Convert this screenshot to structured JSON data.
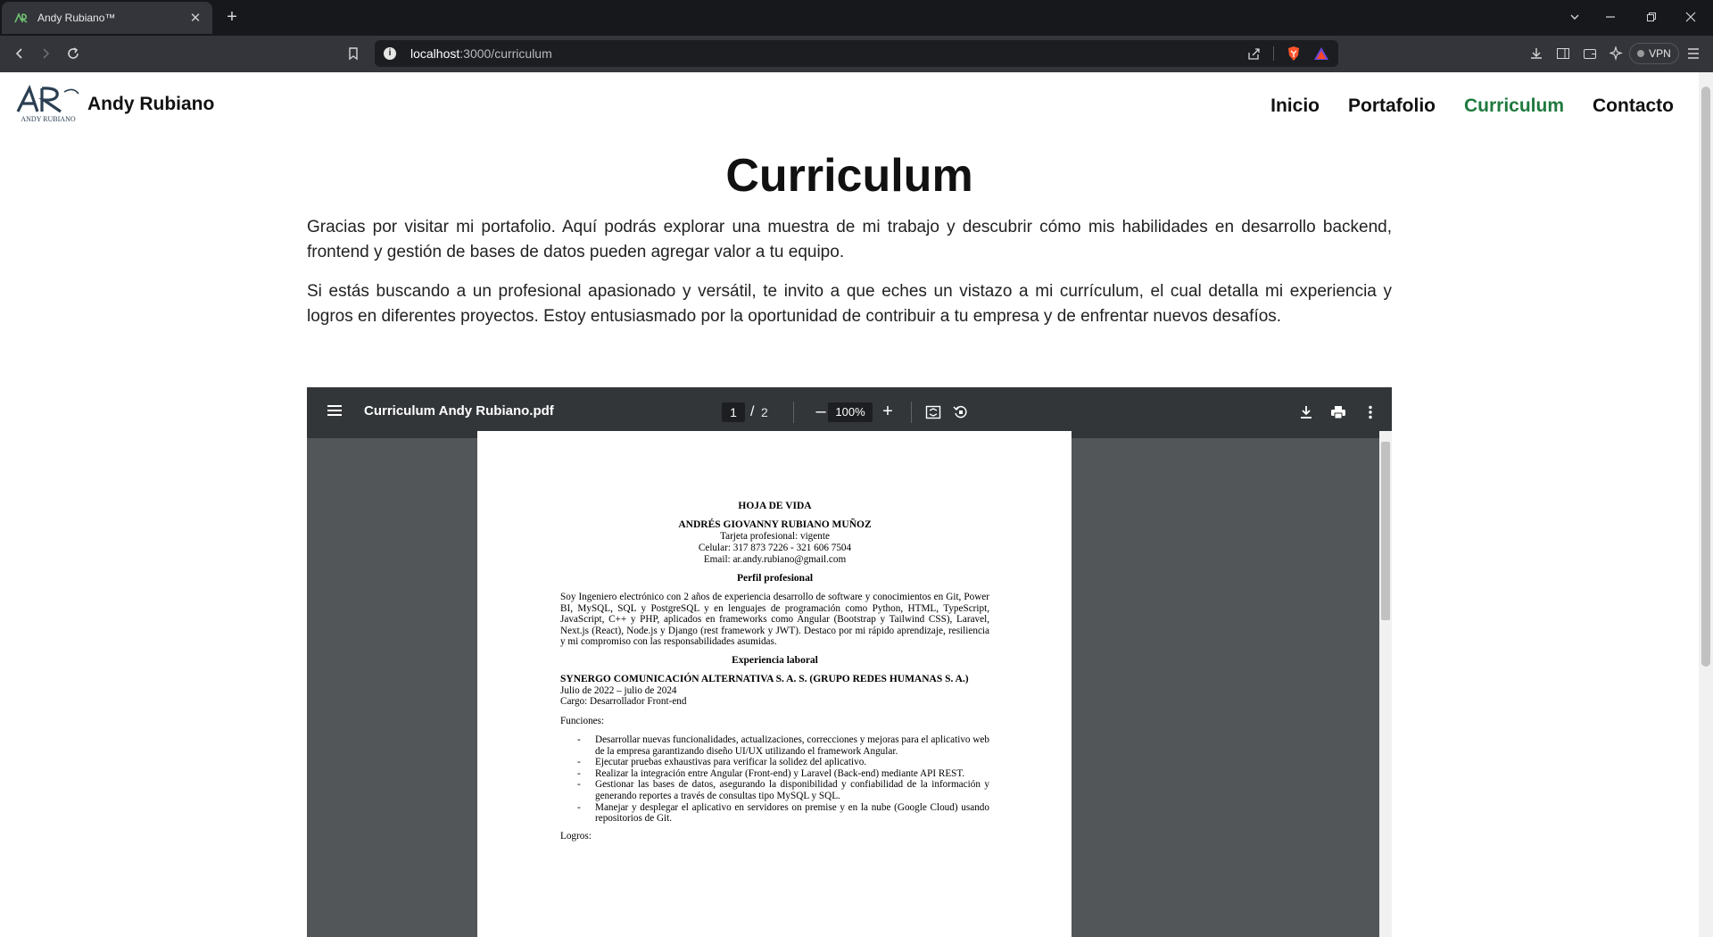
{
  "browser": {
    "tab_title": "Andy Rubiano™",
    "new_tab_label": "+",
    "url_host": "localhost",
    "url_path": ":3000/curriculum",
    "vpn_label": "VPN"
  },
  "site": {
    "brand_name": "Andy Rubiano",
    "logo_text": "AR",
    "logo_subtext": "ANDY RUBIANO",
    "nav": {
      "inicio": "Inicio",
      "portafolio": "Portafolio",
      "curriculum": "Curriculum",
      "contacto": "Contacto"
    },
    "active_nav": "curriculum",
    "accent_color": "#1f7a3e"
  },
  "main": {
    "title": "Curriculum",
    "intro_p1": "Gracias por visitar mi portafolio. Aquí podrás explorar una muestra de mi trabajo y descubrir cómo mis habilidades en desarrollo backend, frontend y gestión de bases de datos pueden agregar valor a tu equipo.",
    "intro_p2": "Si estás buscando a un profesional apasionado y versátil, te invito a que eches un vistazo a mi currículum, el cual detalla mi experiencia y logros en diferentes proyectos. Estoy entusiasmado por la oportunidad de contribuir a tu empresa y de enfrentar nuevos desafíos."
  },
  "pdf": {
    "filename": "Curriculum Andy Rubiano.pdf",
    "current_page": "1",
    "page_separator": "/",
    "total_pages": "2",
    "zoom": "100%",
    "zoom_minus": "–",
    "zoom_plus": "+",
    "doc": {
      "heading": "HOJA DE VIDA",
      "name": "ANDRÉS GIOVANNY RUBIANO MUÑOZ",
      "professional_card": "Tarjeta profesional: vigente",
      "phone": "Celular: 317 873 7226 - 321 606 7504",
      "email": "Email: ar.andy.rubiano@gmail.com",
      "profile_heading": "Perfil profesional",
      "profile_text": "Soy Ingeniero electrónico con 2 años de experiencia desarrollo de software y conocimientos en Git, Power BI, MySQL, SQL y PostgreSQL y en lenguajes de programación como Python, HTML, TypeScript, JavaScript, C++ y PHP, aplicados en frameworks como Angular (Bootstrap y Tailwind CSS), Laravel, Next.js (React), Node.js y Django (rest framework y JWT). Destaco por mi rápido aprendizaje, resiliencia y mi compromiso con las responsabilidades asumidas.",
      "experience_heading": "Experiencia laboral",
      "company": "SYNERGO COMUNICACIÓN ALTERNATIVA S. A. S. (GRUPO REDES HUMANAS S. A.)",
      "period": "Julio de 2022 – julio de 2024",
      "role": "Cargo: Desarrollador Front-end",
      "functions_label": "Funciones:",
      "bullet": "-",
      "functions": [
        "Desarrollar nuevas funcionalidades, actualizaciones, correcciones y mejoras para el aplicativo web de la empresa garantizando diseño UI/UX utilizando el framework Angular.",
        "Ejecutar pruebas exhaustivas para verificar la solidez del aplicativo.",
        "Realizar la integración entre Angular (Front-end) y Laravel (Back-end) mediante API REST.",
        "Gestionar las bases de datos, asegurando la disponibilidad y confiabilidad de la información y generando reportes a través de consultas tipo MySQL y SQL.",
        "Manejar y desplegar el aplicativo en servidores on premise y en la nube (Google Cloud) usando repositorios de Git."
      ],
      "achievements_label": "Logros:"
    }
  }
}
